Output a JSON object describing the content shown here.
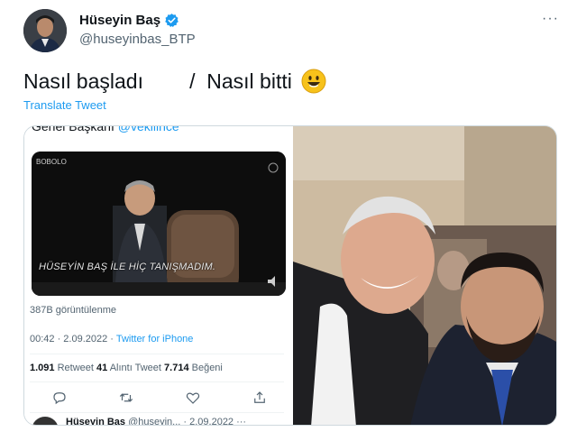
{
  "tweet": {
    "author_name": "Hüseyin Baş",
    "author_handle": "@huseyinbas_BTP",
    "text": "Nasıl başladı        /  Nasıl bitti",
    "translate_label": "Translate Tweet",
    "more_label": "···"
  },
  "quoted": {
    "top_text": "Genel Başkanı ",
    "top_mention": "@vekilince",
    "video_logo": "BOBOLO",
    "video_caption": "HÜSEYİN BAŞ İLE HİÇ TANIŞMADIM.",
    "views": "387B görüntülenme",
    "time": "00:42 · 2.09.2022 · ",
    "source": "Twitter for iPhone",
    "retweet_count": "1.091",
    "retweet_label": " Retweet  ",
    "quote_count": "41",
    "quote_label": " Alıntı Tweet  ",
    "like_count": "7.714",
    "like_label": " Beğeni",
    "reply_name": "Hüseyin Baş",
    "reply_handle": " @huseyin... · 2.09.2022 ···"
  },
  "colors": {
    "accent": "#1d9bf0",
    "text": "#0f1419",
    "muted": "#536471"
  },
  "icons": [
    "verified-badge-icon",
    "smile-emoji-icon",
    "reply-icon",
    "retweet-icon",
    "like-icon",
    "share-icon",
    "more-icon"
  ]
}
